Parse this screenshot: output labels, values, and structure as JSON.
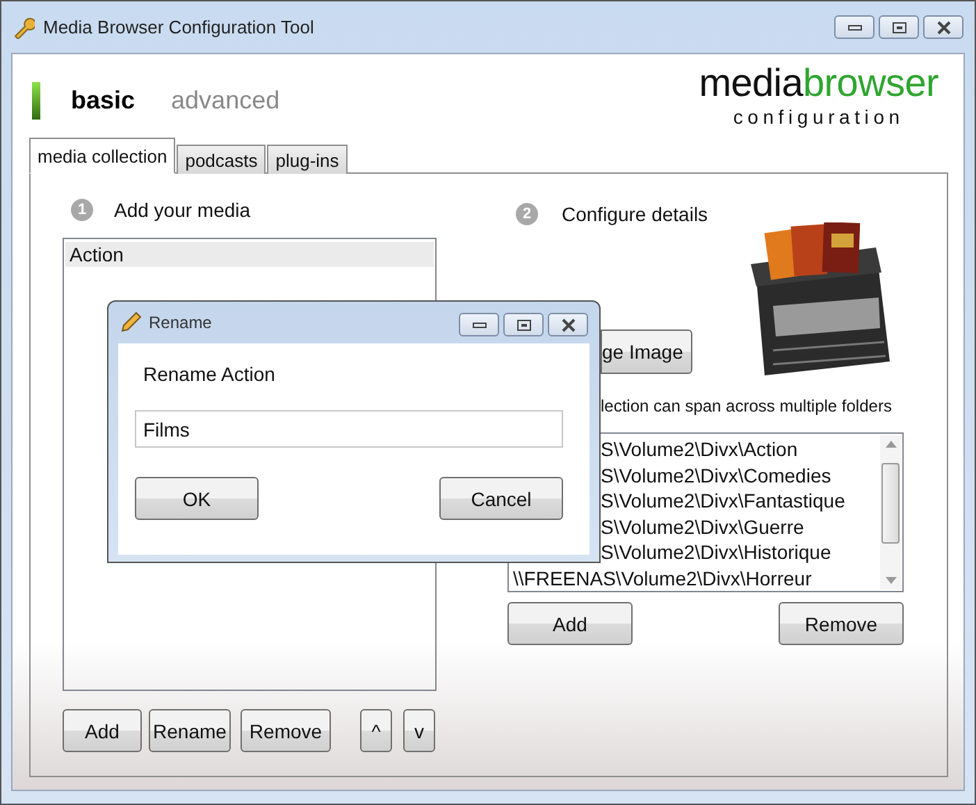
{
  "window": {
    "title": "Media Browser Configuration Tool"
  },
  "modes": [
    {
      "label": "basic",
      "selected": true
    },
    {
      "label": "advanced",
      "selected": false
    }
  ],
  "logo": {
    "dark": "media",
    "accent": "browser",
    "subtitle": "configuration"
  },
  "tabs": [
    {
      "label": "media collection",
      "selected": true
    },
    {
      "label": "podcasts",
      "selected": false
    },
    {
      "label": "plug-ins",
      "selected": false
    }
  ],
  "media": {
    "step": "1",
    "heading": "Add your media",
    "items": [
      {
        "label": "Action",
        "selected": true
      }
    ],
    "buttons": [
      "Add",
      "Rename",
      "Remove",
      "^",
      "v"
    ]
  },
  "details": {
    "step": "2",
    "heading": "Configure details",
    "image_button": "ge Image",
    "caption": "lection can span across multiple folders",
    "folders": [
      {
        "path": "S\\Volume2\\Divx\\Action",
        "kind": "covered"
      },
      {
        "path": "S\\Volume2\\Divx\\Comedies",
        "kind": "covered"
      },
      {
        "path": "S\\Volume2\\Divx\\Fantastique",
        "kind": "covered"
      },
      {
        "path": "S\\Volume2\\Divx\\Guerre",
        "kind": "covered"
      },
      {
        "path": "S\\Volume2\\Divx\\Historique",
        "kind": "covered"
      },
      {
        "path": "\\\\FREENAS\\Volume2\\Divx\\Horreur",
        "kind": "plain"
      }
    ],
    "buttons": [
      "Add",
      "Remove"
    ]
  },
  "dialog": {
    "title": "Rename",
    "prompt": "Rename Action",
    "value": "Films",
    "buttons": [
      "OK",
      "Cancel"
    ]
  }
}
